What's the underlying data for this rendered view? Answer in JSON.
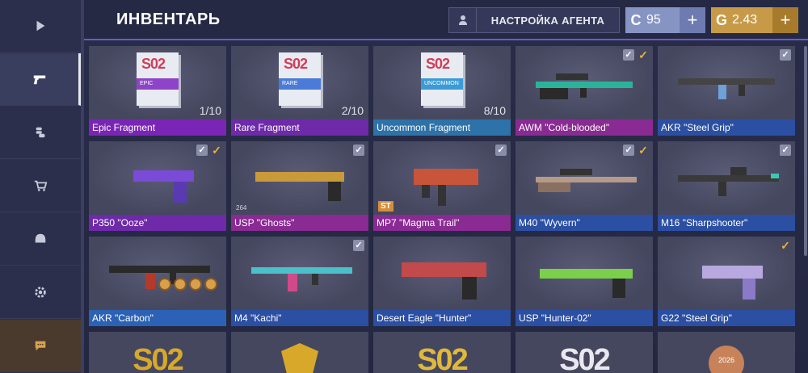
{
  "header": {
    "title": "ИНВЕНТАРЬ",
    "agent_button": "НАСТРОЙКА АГЕНТА",
    "currency_silver": {
      "symbol": "C",
      "value": "95",
      "plus": "+"
    },
    "currency_gold": {
      "symbol": "G",
      "value": "2.43",
      "plus": "+"
    }
  },
  "sidebar": {
    "items": [
      {
        "icon": "play-icon"
      },
      {
        "icon": "pistol-icon"
      },
      {
        "icon": "coins-icon"
      },
      {
        "icon": "cart-icon"
      },
      {
        "icon": "helmet-icon"
      },
      {
        "icon": "gear-icon"
      },
      {
        "icon": "chat-icon"
      }
    ]
  },
  "items": [
    {
      "name": "Epic Fragment",
      "count": "1/10",
      "frag_label": "EPIC",
      "frag_color": "#8e44c8"
    },
    {
      "name": "Rare Fragment",
      "count": "2/10",
      "frag_label": "RARE",
      "frag_color": "#4a7bd8"
    },
    {
      "name": "Uncommon Fragment",
      "count": "8/10",
      "frag_label": "UNCOMMON",
      "frag_color": "#3b9bd6"
    },
    {
      "name": "AWM \"Cold-blooded\""
    },
    {
      "name": "AKR \"Steel Grip\""
    },
    {
      "name": "P350 \"Ooze\""
    },
    {
      "name": "USP \"Ghosts\"",
      "extra": "264"
    },
    {
      "name": "MP7 \"Magma Trail\"",
      "badge": "ST"
    },
    {
      "name": "M40 \"Wyvern\""
    },
    {
      "name": "M16 \"Sharpshooter\""
    },
    {
      "name": "AKR \"Carbon\""
    },
    {
      "name": "M4 \"Kachi\""
    },
    {
      "name": "Desert Eagle \"Hunter\""
    },
    {
      "name": "USP \"Hunter-02\""
    },
    {
      "name": "G22 \"Steel Grip\""
    }
  ],
  "bottom_row": {
    "s02_text": "S02",
    "badge_year": "2026"
  },
  "colors": {
    "accent_gold": "#c79a47",
    "accent_silver": "#8694c4",
    "epic": "#7a25b5",
    "rare": "#2b4fa2"
  }
}
